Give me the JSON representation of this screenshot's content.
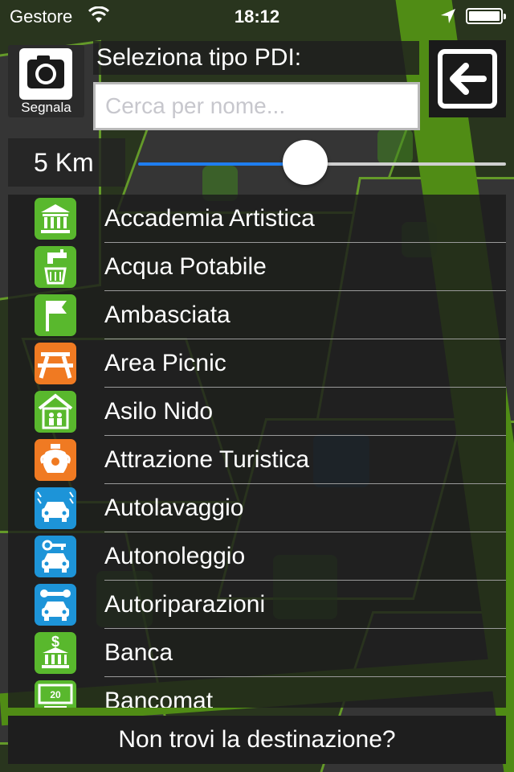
{
  "status_bar": {
    "carrier": "Gestore",
    "time": "18:12"
  },
  "camera": {
    "label": "Segnala",
    "icon": "camera-icon"
  },
  "back": {
    "icon": "arrow-left-icon"
  },
  "search": {
    "title": "Seleziona tipo PDI:",
    "placeholder": "Cerca per nome..."
  },
  "distance": {
    "label": "5 Km",
    "fraction": 0.45
  },
  "poi_types": [
    {
      "label": "Accademia Artistica",
      "icon": "museum-icon",
      "color": "#59b82d"
    },
    {
      "label": "Acqua Potabile",
      "icon": "water-tap-icon",
      "color": "#59b82d"
    },
    {
      "label": "Ambasciata",
      "icon": "flag-icon",
      "color": "#59b82d"
    },
    {
      "label": "Area Picnic",
      "icon": "picnic-table-icon",
      "color": "#f07a22"
    },
    {
      "label": "Asilo Nido",
      "icon": "nursery-house-icon",
      "color": "#59b82d"
    },
    {
      "label": "Attrazione Turistica",
      "icon": "vase-icon",
      "color": "#f07a22"
    },
    {
      "label": "Autolavaggio",
      "icon": "car-wash-icon",
      "color": "#1d94d8"
    },
    {
      "label": "Autonoleggio",
      "icon": "car-rental-icon",
      "color": "#1d94d8"
    },
    {
      "label": "Autoriparazioni",
      "icon": "car-repair-icon",
      "color": "#1d94d8"
    },
    {
      "label": "Banca",
      "icon": "bank-icon",
      "color": "#59b82d"
    },
    {
      "label": "Bancomat",
      "icon": "atm-icon",
      "color": "#59b82d"
    }
  ],
  "footer": {
    "label": "Non trovi la destinazione?"
  }
}
